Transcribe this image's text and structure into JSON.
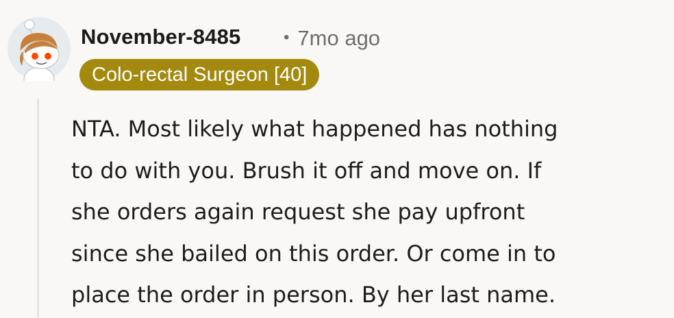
{
  "comment": {
    "author": "November-8485",
    "separator": "•",
    "timestamp": "7mo ago",
    "flair": "Colo-rectal Surgeon [40]",
    "body_lines": [
      "NTA. Most likely what happened has nothing",
      "to do with you. Brush it off and move on. If",
      "she orders again request she pay upfront",
      "since she bailed on this order. Or come in to",
      "place the order in person. By her last name."
    ]
  },
  "avatar": {
    "icon": "snoo-avatar-icon"
  },
  "colors": {
    "background": "#f9f8f6",
    "flair_background": "#a38a0f",
    "flair_text": "#ffffff",
    "username": "#1a1a1b",
    "meta": "#6e6e6e",
    "thread_line": "#e6e2dc"
  }
}
